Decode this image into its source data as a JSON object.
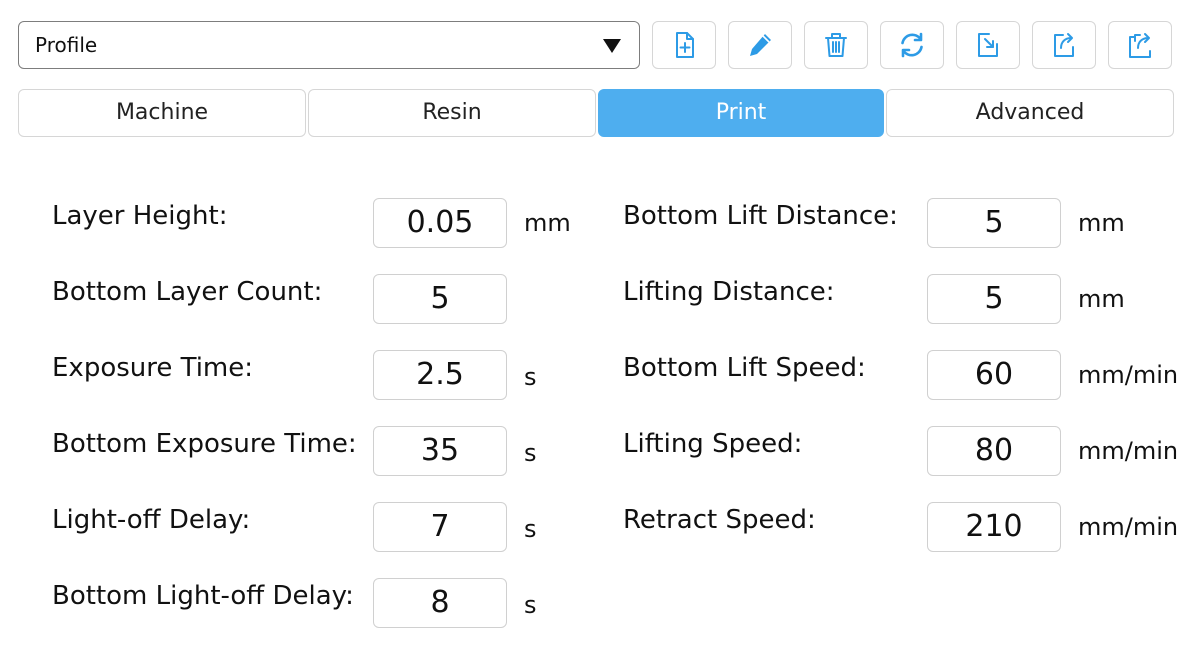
{
  "profile": {
    "selected": "Profile"
  },
  "toolbar": {
    "buttons": [
      {
        "name": "new-profile-button",
        "icon": "file-plus-icon"
      },
      {
        "name": "edit-profile-button",
        "icon": "pencil-icon"
      },
      {
        "name": "delete-profile-button",
        "icon": "trash-icon"
      },
      {
        "name": "refresh-profile-button",
        "icon": "refresh-icon"
      },
      {
        "name": "import-profile-button",
        "icon": "import-icon"
      },
      {
        "name": "export-profile-button",
        "icon": "export-icon"
      },
      {
        "name": "share-profile-button",
        "icon": "share-icon"
      }
    ],
    "icon_color": "#2d9be6"
  },
  "tabs": [
    {
      "label": "Machine",
      "active": false
    },
    {
      "label": "Resin",
      "active": false
    },
    {
      "label": "Print",
      "active": true
    },
    {
      "label": "Advanced",
      "active": false
    }
  ],
  "accent_color": "#4eaeef",
  "left_fields": [
    {
      "label": "Layer Height:",
      "value": "0.05",
      "unit": "mm"
    },
    {
      "label": "Bottom Layer Count:",
      "value": "5",
      "unit": ""
    },
    {
      "label": "Exposure Time:",
      "value": "2.5",
      "unit": "s"
    },
    {
      "label": "Bottom Exposure Time:",
      "value": "35",
      "unit": "s"
    },
    {
      "label": "Light-off Delay:",
      "value": "7",
      "unit": "s"
    },
    {
      "label": "Bottom Light-off Delay:",
      "value": "8",
      "unit": "s"
    }
  ],
  "right_fields": [
    {
      "label": "Bottom Lift Distance:",
      "value": "5",
      "unit": "mm"
    },
    {
      "label": "Lifting Distance:",
      "value": "5",
      "unit": "mm"
    },
    {
      "label": "Bottom Lift Speed:",
      "value": "60",
      "unit": "mm/min"
    },
    {
      "label": "Lifting Speed:",
      "value": "80",
      "unit": "mm/min"
    },
    {
      "label": "Retract Speed:",
      "value": "210",
      "unit": "mm/min"
    }
  ]
}
